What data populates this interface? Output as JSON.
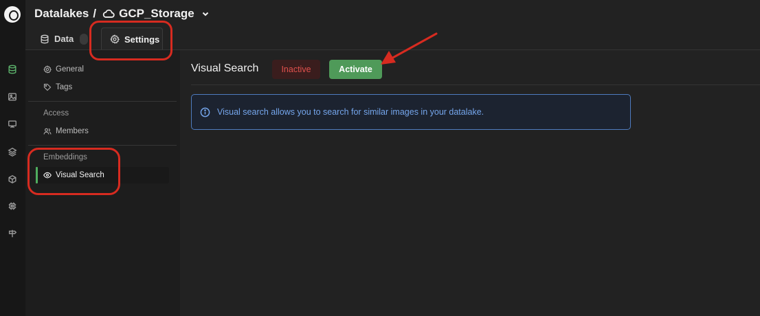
{
  "header": {
    "crumb_root": "Datalakes",
    "crumb_sep": "/",
    "crumb_current": "GCP_Storage",
    "tabs": [
      {
        "label": "Data",
        "icon": "database-icon"
      },
      {
        "label": "Settings",
        "icon": "gear-icon"
      }
    ]
  },
  "rail": {
    "icons": [
      "logo",
      "database-icon",
      "image-icon",
      "presentation-icon",
      "layers-icon",
      "package-icon",
      "chip-icon",
      "signpost-icon"
    ],
    "active": "database-icon"
  },
  "sidebar": {
    "general": "General",
    "tags": "Tags",
    "access_header": "Access",
    "members": "Members",
    "embeddings_header": "Embeddings",
    "visual_search": "Visual Search"
  },
  "main": {
    "title": "Visual Search",
    "status_label": "Inactive",
    "activate_label": "Activate",
    "info_text": "Visual search allows you to search for similar images in your datalake."
  },
  "colors": {
    "accent_green": "#4f9a59",
    "inactive_red": "#e0514d",
    "info_blue": "#75a6ec",
    "annotation_red": "#d72b20"
  }
}
